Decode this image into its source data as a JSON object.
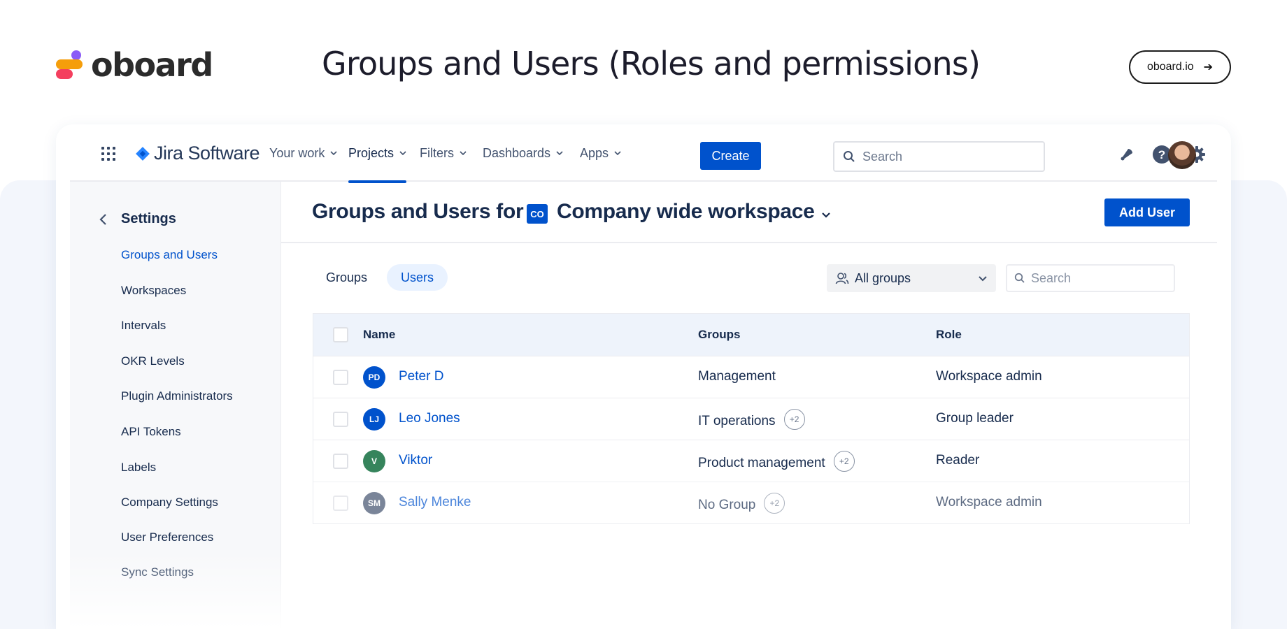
{
  "brand": {
    "name": "oboard"
  },
  "page_title": "Groups and Users (Roles and permissions)",
  "site_link": {
    "label": "oboard.io",
    "arrow": "➔"
  },
  "colors": {
    "accent": "#0052cc",
    "background_band": "#f3f6fc"
  },
  "topnav": {
    "product": "Jira Software",
    "items": [
      {
        "label": "Your work"
      },
      {
        "label": "Projects"
      },
      {
        "label": "Filters"
      },
      {
        "label": "Dashboards"
      },
      {
        "label": "Apps"
      }
    ],
    "active": "Projects",
    "create_label": "Create",
    "search_placeholder": "Search",
    "icons": [
      "apps-grid-icon",
      "notifications-icon",
      "help-icon",
      "settings-icon"
    ]
  },
  "sidebar": {
    "title": "Settings",
    "items": [
      {
        "label": "Groups and Users"
      },
      {
        "label": "Workspaces"
      },
      {
        "label": "Intervals"
      },
      {
        "label": "OKR Levels"
      },
      {
        "label": "Plugin Administrators"
      },
      {
        "label": "API Tokens"
      },
      {
        "label": "Labels"
      },
      {
        "label": "Company Settings"
      },
      {
        "label": "User Preferences"
      },
      {
        "label": "Sync Settings"
      }
    ],
    "active": "Groups and Users"
  },
  "main": {
    "title": "Groups and Users for",
    "workspace_badge": "CO",
    "workspace_name": "Company wide workspace",
    "add_user_label": "Add User",
    "tabs": [
      {
        "label": "Groups"
      },
      {
        "label": "Users"
      }
    ],
    "active_tab": "Users",
    "groups_filter": "All groups",
    "search_placeholder": "Search",
    "table": {
      "headers": {
        "name": "Name",
        "groups": "Groups",
        "role": "Role"
      },
      "rows": [
        {
          "initials": "PD",
          "name": "Peter D",
          "group": "Management",
          "extra": "",
          "role": "Workspace admin",
          "avatar_color": "#0052cc"
        },
        {
          "initials": "LJ",
          "name": "Leo Jones",
          "group": "IT operations",
          "extra": "+2",
          "role": "Group leader",
          "avatar_color": "#0052cc"
        },
        {
          "initials": "V",
          "name": "Viktor",
          "group": "Product management",
          "extra": "+2",
          "role": "Reader",
          "avatar_color": "#36845c"
        },
        {
          "initials": "SM",
          "name": "Sally Menke",
          "group": "No Group",
          "extra": "+2",
          "role": "Workspace admin",
          "avatar_color": "#42526e"
        }
      ]
    }
  }
}
